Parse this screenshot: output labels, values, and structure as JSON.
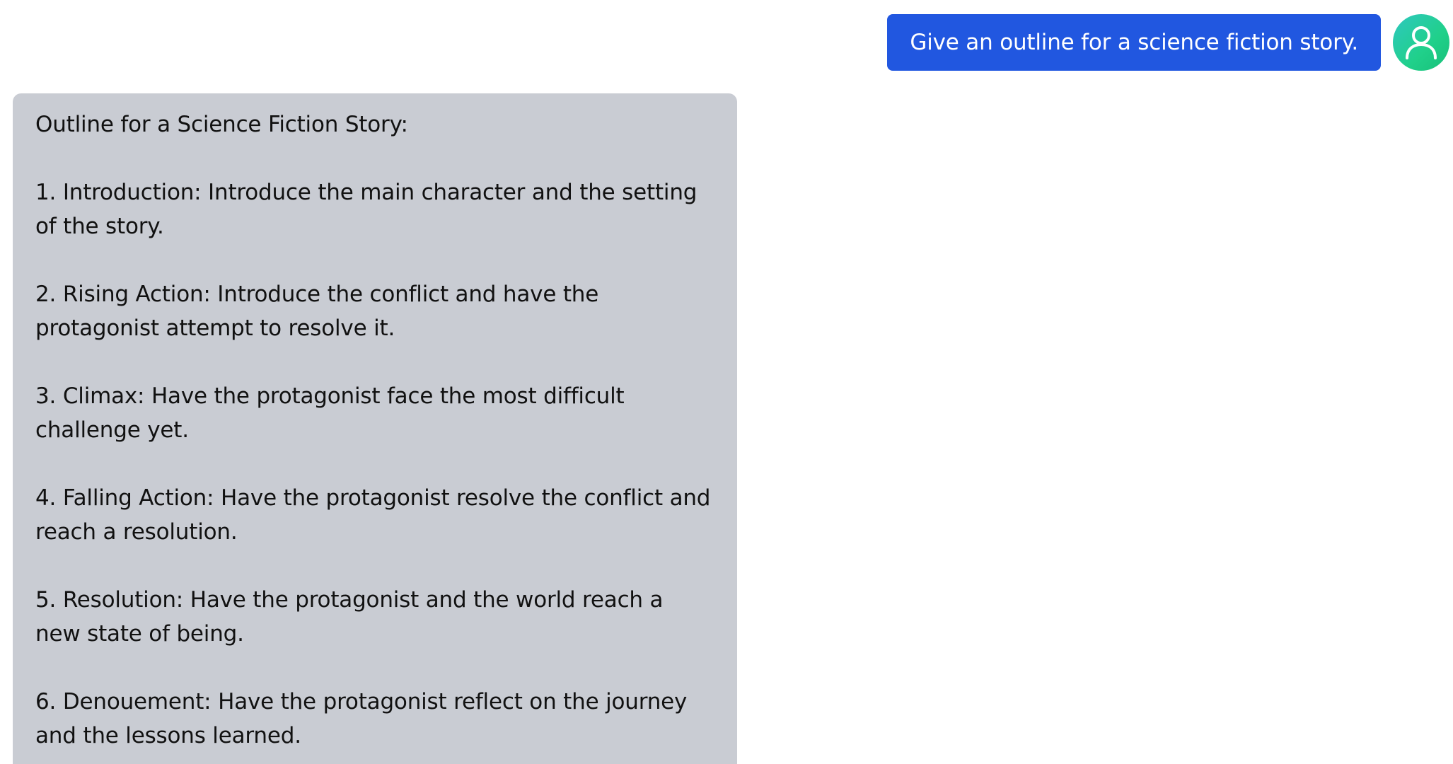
{
  "user_message": {
    "text": "Give an outline for a science fiction story."
  },
  "avatar": {
    "icon": "user-icon",
    "colors": [
      "#2fc8c0",
      "#18c079"
    ]
  },
  "bot_message": {
    "heading": "Outline for a Science Fiction Story:",
    "items": [
      "1. Introduction: Introduce the main character and the setting of the story.",
      "2. Rising Action: Introduce the conflict and have the protagonist attempt to resolve it.",
      "3. Climax: Have the protagonist face the most difficult challenge yet.",
      "4. Falling Action: Have the protagonist resolve the conflict and reach a resolution.",
      "5. Resolution: Have the protagonist and the world reach a new state of being.",
      "6. Denouement: Have the protagonist reflect on the journey and the lessons learned."
    ]
  },
  "colors": {
    "user_bubble": "#2157e0",
    "bot_bubble": "#c9ccd3"
  }
}
